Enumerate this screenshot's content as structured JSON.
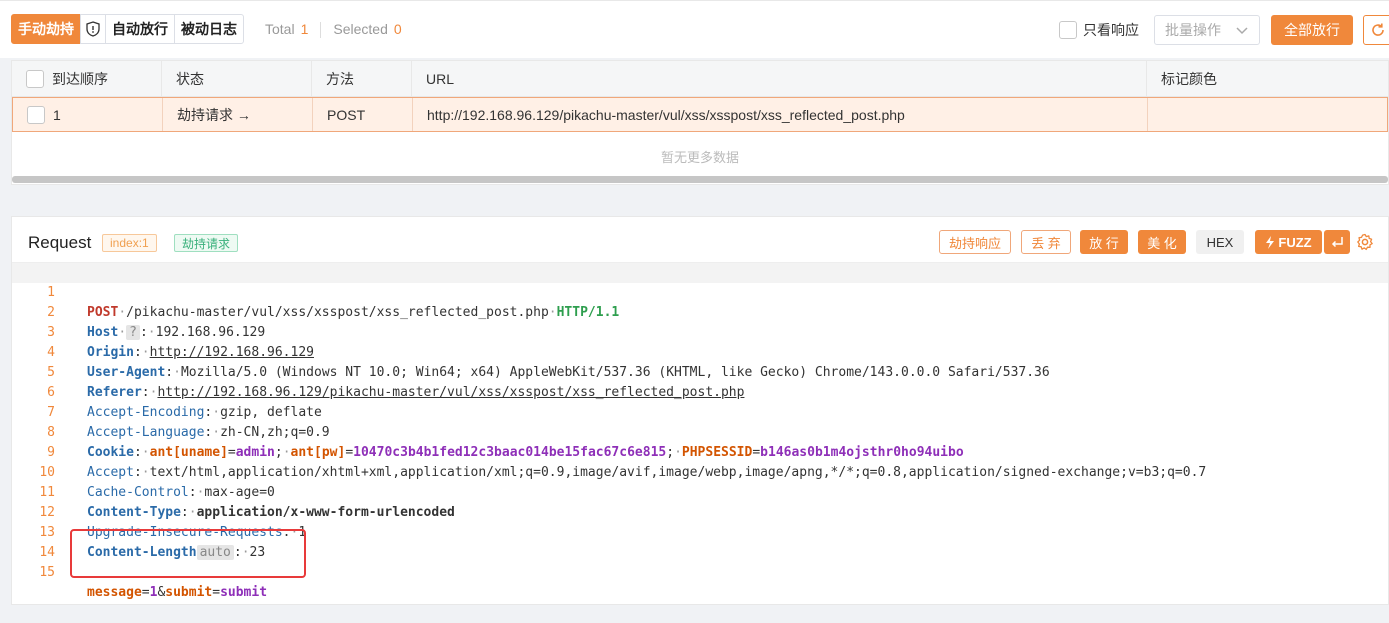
{
  "toolbar": {
    "manual_hijack": "手动劫持",
    "auto_release": "自动放行",
    "passive_log": "被动日志",
    "total_label": "Total",
    "total_value": "1",
    "selected_label": "Selected",
    "selected_value": "0",
    "response_only": "只看响应",
    "batch_placeholder": "批量操作",
    "release_all": "全部放行"
  },
  "table": {
    "columns": [
      "到达顺序",
      "状态",
      "方法",
      "URL",
      "标记颜色"
    ],
    "rows": [
      {
        "order": "1",
        "status": "劫持请求 →",
        "method": "POST",
        "url": "http://192.168.96.129/pikachu-master/vul/xss/xsspost/xss_reflected_post.php",
        "color": ""
      }
    ],
    "empty_text": "暂无更多数据"
  },
  "request": {
    "title": "Request",
    "index_tag": "index:1",
    "status_tag": "劫持请求",
    "btn_hijack_resp": "劫持响应",
    "btn_discard": "丢 弃",
    "btn_release": "放 行",
    "btn_beautify": "美 化",
    "btn_hex": "HEX",
    "btn_fuzz": "FUZZ",
    "lines": {
      "l1": {
        "no": "1",
        "method": "POST",
        "path": "/pikachu-master/vul/xss/xsspost/xss_reflected_post.php",
        "ver": "HTTP/1.1"
      },
      "l2": {
        "no": "2",
        "key": "Host",
        "badge": "?",
        "val": "192.168.96.129"
      },
      "l3": {
        "no": "3",
        "key": "Origin",
        "val": "http://192.168.96.129"
      },
      "l4": {
        "no": "4",
        "key": "User-Agent",
        "val": "Mozilla/5.0 (Windows NT 10.0; Win64; x64) AppleWebKit/537.36 (KHTML, like Gecko) Chrome/143.0.0.0 Safari/537.36"
      },
      "l5": {
        "no": "5",
        "key": "Referer",
        "val": "http://192.168.96.129/pikachu-master/vul/xss/xsspost/xss_reflected_post.php"
      },
      "l6": {
        "no": "6",
        "key": "Accept-Encoding",
        "val": "gzip, deflate"
      },
      "l7": {
        "no": "7",
        "key": "Accept-Language",
        "val": "zh-CN,zh;q=0.9"
      },
      "l8": {
        "no": "8",
        "key": "Cookie",
        "c1k": "ant[uname]",
        "c1v": "admin",
        "c2k": "ant[pw]",
        "c2v": "10470c3b4b1fed12c3baac014be15fac67c6e815",
        "c3k": "PHPSESSID",
        "c3v": "b146as0b1m4ojsthr0ho94uibo"
      },
      "l9": {
        "no": "9",
        "key": "Accept",
        "val": "text/html,application/xhtml+xml,application/xml;q=0.9,image/avif,image/webp,image/apng,*/*;q=0.8,application/signed-exchange;v=b3;q=0.7"
      },
      "l10": {
        "no": "10",
        "key": "Cache-Control",
        "val": "max-age=0"
      },
      "l11": {
        "no": "11",
        "key": "Content-Type",
        "val": "application/x-www-form-urlencoded"
      },
      "l12": {
        "no": "12",
        "key": "Upgrade-Insecure-Requests",
        "val": "1"
      },
      "l13": {
        "no": "13",
        "key": "Content-Length",
        "badge": "auto",
        "val": "23"
      },
      "l14": {
        "no": "14"
      },
      "l15": {
        "no": "15",
        "p1k": "message",
        "p1v": "1",
        "p2k": "submit",
        "p2v": "submit"
      }
    }
  },
  "colors": {
    "accent": "#f0883b",
    "highlight_box": "#e83a3a"
  }
}
